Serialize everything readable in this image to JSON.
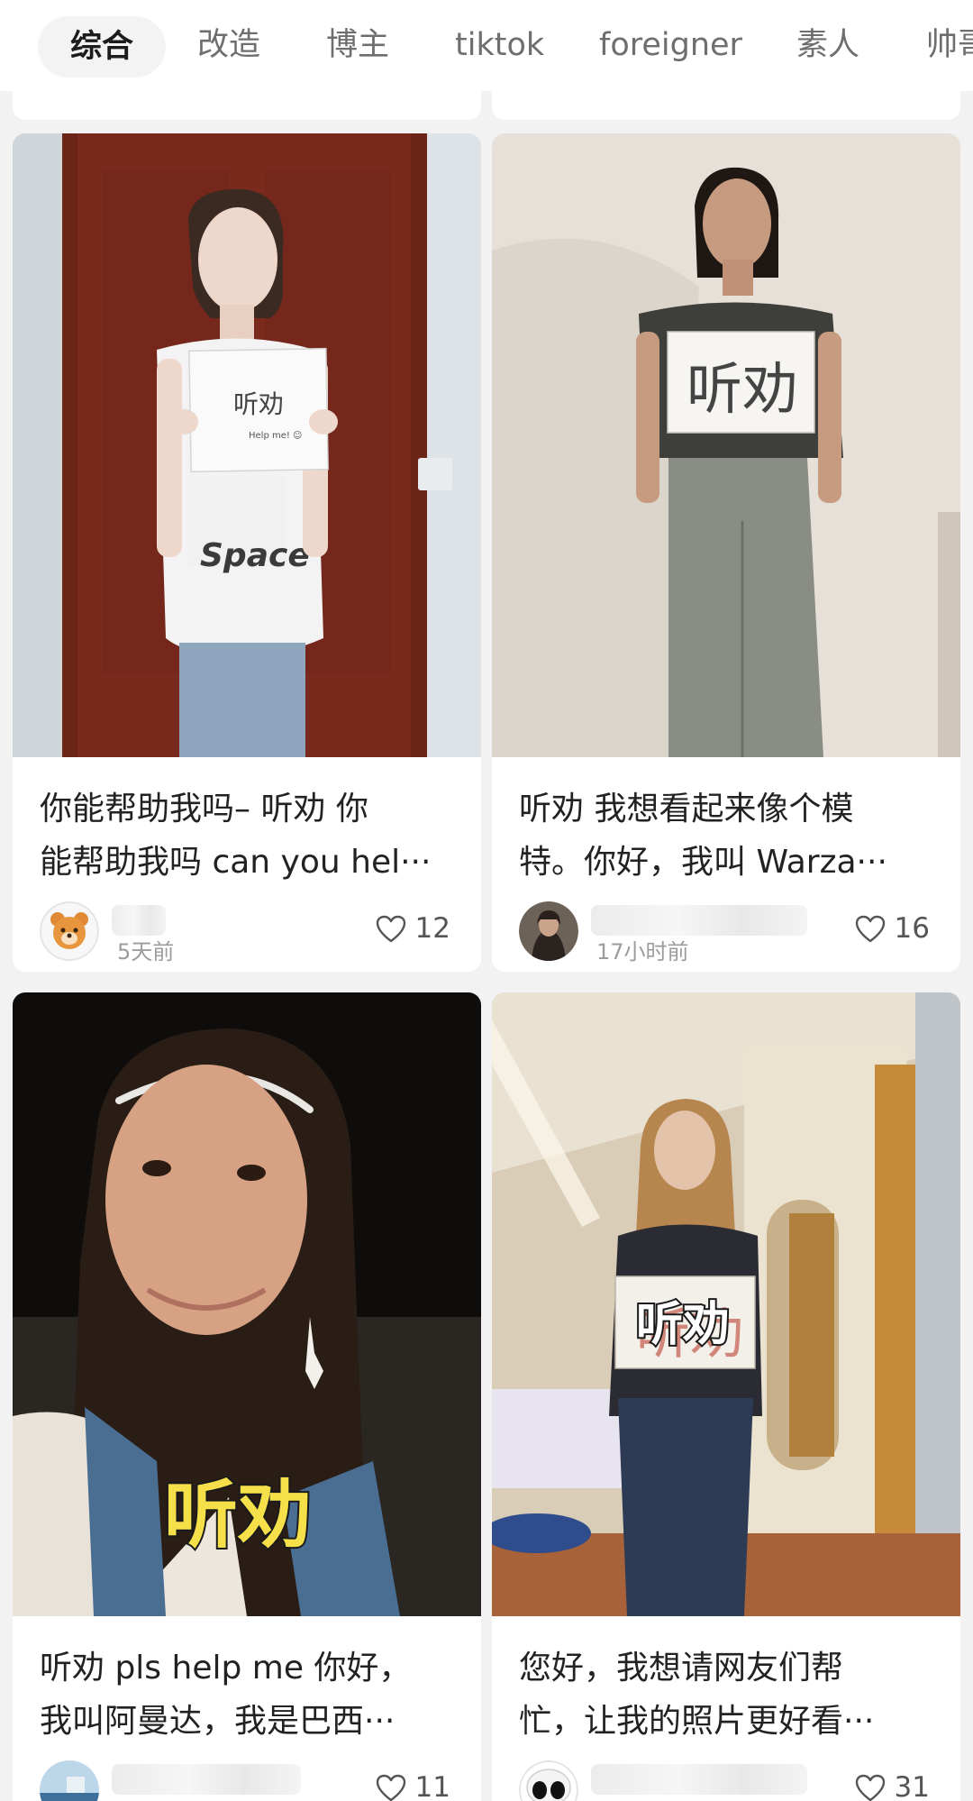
{
  "tabs": [
    {
      "label": "综合",
      "active": true
    },
    {
      "label": "改造",
      "active": false
    },
    {
      "label": "博主",
      "active": false
    },
    {
      "label": "tiktok",
      "active": false
    },
    {
      "label": "foreigner",
      "active": false
    },
    {
      "label": "素人",
      "active": false
    },
    {
      "label": "帅哥",
      "active": false
    }
  ],
  "cards": [
    {
      "title_lines": [
        "你能帮助我吗– 听劝 你",
        "能帮助我吗 can you hel···"
      ],
      "timestamp": "5天前",
      "likes": "12",
      "sign_text": "听劝",
      "sign_subtext": "Help me! ☺",
      "shirt_text": "Space"
    },
    {
      "title_lines": [
        "听劝 我想看起来像个模",
        "特。你好，我叫 Warza···"
      ],
      "timestamp": "17小时前",
      "likes": "16",
      "sign_text": "听劝"
    },
    {
      "title_lines": [
        "听劝 pls help me 你好，",
        "我叫阿曼达，我是巴西···"
      ],
      "timestamp": "",
      "likes": "11",
      "overlay_text": "听劝"
    },
    {
      "title_lines": [
        "您好，我想请网友们帮",
        "忙，让我的照片更好看···"
      ],
      "timestamp": "",
      "likes": "31",
      "overlay_text": "听劝"
    }
  ],
  "colors": {
    "background": "#f2f2f3",
    "card": "#ffffff",
    "tab_active_bg": "#f3f3f3",
    "overlay_text_fill": "#f5e04a"
  },
  "icons": {
    "like": "heart-outline-icon",
    "avatar_1": "bear-avatar-icon"
  }
}
